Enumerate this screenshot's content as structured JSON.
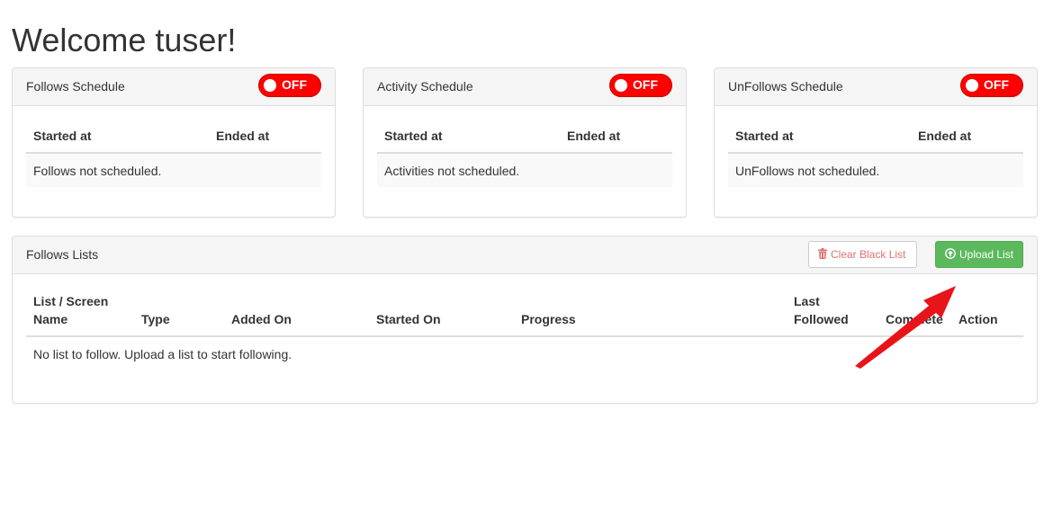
{
  "page": {
    "title": "Welcome tuser!"
  },
  "schedules": [
    {
      "title": "Follows Schedule",
      "toggle": "OFF",
      "columns": [
        "Started at",
        "Ended at"
      ],
      "empty_message": "Follows not scheduled."
    },
    {
      "title": "Activity Schedule",
      "toggle": "OFF",
      "columns": [
        "Started at",
        "Ended at"
      ],
      "empty_message": "Activities not scheduled."
    },
    {
      "title": "UnFollows Schedule",
      "toggle": "OFF",
      "columns": [
        "Started at",
        "Ended at"
      ],
      "empty_message": "UnFollows not scheduled."
    }
  ],
  "follows_lists": {
    "title": "Follows Lists",
    "clear_button": "Clear Black List",
    "upload_button": "Upload List",
    "columns": {
      "name_line1": "List / Screen",
      "name_line2": "Name",
      "type": "Type",
      "added_on": "Added On",
      "started_on": "Started On",
      "progress": "Progress",
      "last_followed": "Last Followed",
      "complete": "Complete",
      "action": "Action"
    },
    "empty_message": "No list to follow. Upload a list to start following."
  },
  "icons": {
    "clear": "trash-icon",
    "upload": "circle-arrow-up-icon",
    "annotation": "red-arrow-annotation"
  },
  "colors": {
    "toggle_off": "#ff0000",
    "upload_button": "#5cb85c",
    "clear_button_text": "#e07070",
    "annotation_arrow": "#e8141a"
  }
}
